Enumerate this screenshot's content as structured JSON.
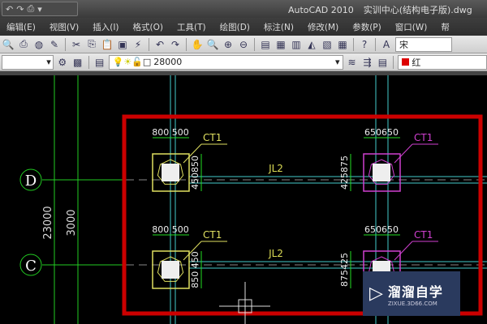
{
  "app": {
    "name": "AutoCAD 2010",
    "file": "实训中心(结构电子版).dwg"
  },
  "menu": [
    "编辑(E)",
    "视图(V)",
    "插入(I)",
    "格式(O)",
    "工具(T)",
    "绘图(D)",
    "标注(N)",
    "修改(M)",
    "参数(P)",
    "窗口(W)",
    "帮"
  ],
  "toolbar": {
    "font_value": "宋",
    "layer_value": "28000",
    "color_value": "红"
  },
  "drawing": {
    "axes": [
      "D",
      "C"
    ],
    "dims_vertical": [
      "23000",
      "3000"
    ],
    "piles": [
      {
        "top_dim": "800 500",
        "label": "CT1",
        "side_dim": "450850",
        "color": "#e0e060"
      },
      {
        "top_dim": "650650",
        "label": "CT1",
        "side_dim": "425875",
        "color": "#d040d0"
      },
      {
        "top_dim": "800 500",
        "label": "CT1",
        "side_dim": "850 450",
        "color": "#e0e060"
      },
      {
        "top_dim": "650650",
        "label": "CT1",
        "side_dim": "875425",
        "color": "#d040d0"
      }
    ],
    "beam_label": "JL2",
    "highlight_color": "#cc0000"
  },
  "watermark": {
    "name": "溜溜自学",
    "url": "ZIXUE.3D66.COM"
  }
}
